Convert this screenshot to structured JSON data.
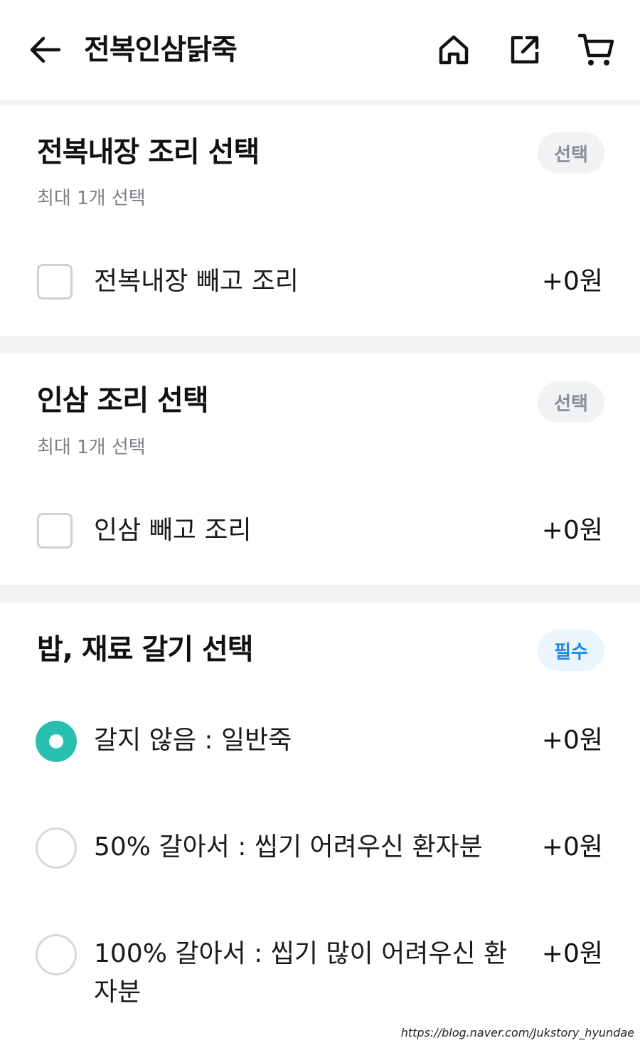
{
  "header": {
    "title": "전복인삼닭죽",
    "icons": [
      "back-arrow-icon",
      "home-icon",
      "share-icon",
      "cart-icon"
    ]
  },
  "sections": [
    {
      "title": "전복내장 조리 선택",
      "subtitle": "최대 1개 선택",
      "badge": "선택",
      "options": [
        {
          "label": "전복내장 빼고 조리",
          "price": "+0원",
          "checked": false
        }
      ]
    },
    {
      "title": "인삼 조리 선택",
      "subtitle": "최대 1개 선택",
      "badge": "선택",
      "options": [
        {
          "label": "인삼 빼고 조리",
          "price": "+0원",
          "checked": false
        }
      ]
    },
    {
      "title": "밥, 재료 갈기 선택",
      "badge": "필수",
      "options": [
        {
          "label": "갈지 않음 : 일반죽",
          "price": "+0원",
          "selected": true
        },
        {
          "label": "50% 갈아서 : 씹기 어려우신 환자분",
          "price": "+0원",
          "selected": false
        },
        {
          "label": "100% 갈아서 : 씹기 많이 어려우신 환자분",
          "price": "+0원",
          "selected": false
        }
      ]
    }
  ],
  "colors": {
    "accent": "#26bfb0",
    "required_badge_text": "#1e86e6",
    "required_badge_bg": "#eaf5fe",
    "optional_badge_text": "#8a8e95",
    "optional_badge_bg": "#f1f2f4",
    "divider": "#f2f3f5"
  },
  "watermark": "https://blog.naver.com/Jukstory_hyundae"
}
